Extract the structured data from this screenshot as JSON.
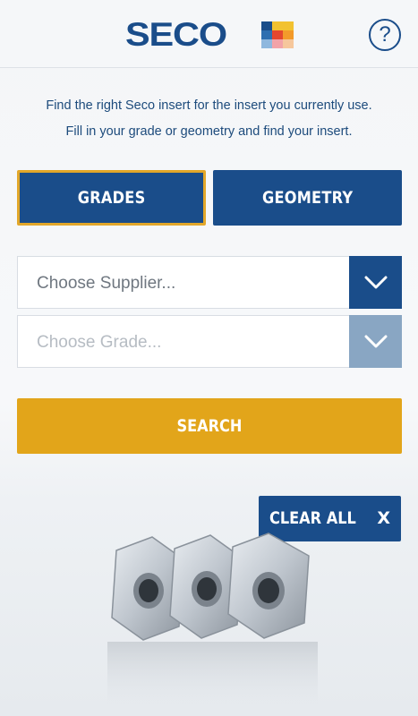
{
  "header": {
    "logo_text": "SECO",
    "logo_colors": [
      "#1a4d8a",
      "#f2c230",
      "#f2c230",
      "#2e6fb0",
      "#e4472f",
      "#f39a2a",
      "#8fb8de",
      "#f2a3a8",
      "#f6c79c"
    ],
    "help_label": "?"
  },
  "intro": {
    "line1": "Find the right Seco insert for the insert you currently use.",
    "line2": "Fill in your grade or geometry and find your insert."
  },
  "tabs": [
    {
      "label": "GRADES",
      "active": true
    },
    {
      "label": "GEOMETRY",
      "active": false
    }
  ],
  "supplier_select": {
    "placeholder": "Choose Supplier...",
    "icon": "chevron-down-icon"
  },
  "grade_select": {
    "placeholder": "Choose Grade...",
    "icon": "chevron-down-icon",
    "disabled": true
  },
  "search_button": {
    "label": "SEARCH"
  },
  "clear_button": {
    "label": "CLEAR ALL",
    "close_label": "X"
  },
  "colors": {
    "primary": "#1a4d8a",
    "accent": "#e2a51a",
    "disabled": "#89a6c3"
  }
}
